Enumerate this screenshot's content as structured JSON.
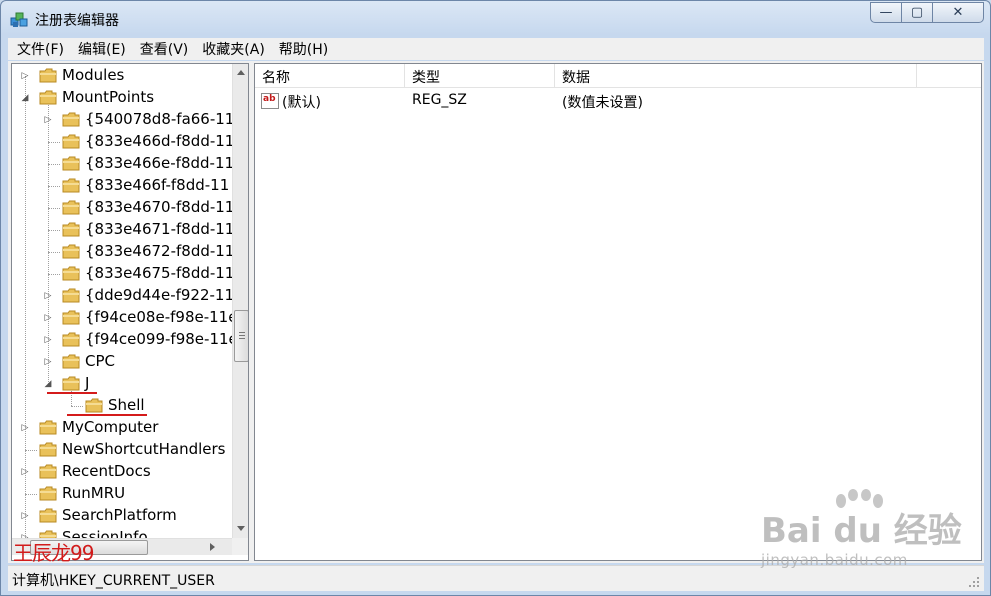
{
  "window": {
    "title": "注册表编辑器",
    "controls": {
      "minimize": "—",
      "maximize": "▢",
      "close": "✕"
    }
  },
  "menu": [
    "文件(F)",
    "编辑(E)",
    "查看(V)",
    "收藏夹(A)",
    "帮助(H)"
  ],
  "tree": {
    "nodes": [
      {
        "label": "Modules",
        "expander": "▷"
      },
      {
        "label": "MountPoints",
        "expander": "◢"
      },
      {
        "label": "{540078d8-fa66-11",
        "expander": "▷"
      },
      {
        "label": "{833e466d-f8dd-11",
        "expander": ""
      },
      {
        "label": "{833e466e-f8dd-11",
        "expander": ""
      },
      {
        "label": "{833e466f-f8dd-11",
        "expander": ""
      },
      {
        "label": "{833e4670-f8dd-11",
        "expander": ""
      },
      {
        "label": "{833e4671-f8dd-11",
        "expander": ""
      },
      {
        "label": "{833e4672-f8dd-11",
        "expander": ""
      },
      {
        "label": "{833e4675-f8dd-11",
        "expander": ""
      },
      {
        "label": "{dde9d44e-f922-11",
        "expander": "▷"
      },
      {
        "label": "{f94ce08e-f98e-11e",
        "expander": "▷"
      },
      {
        "label": "{f94ce099-f98e-11e",
        "expander": "▷"
      },
      {
        "label": "CPC",
        "expander": "▷"
      },
      {
        "label": "J",
        "expander": "◢"
      },
      {
        "label": "Shell",
        "expander": ""
      },
      {
        "label": "MyComputer",
        "expander": "▷"
      },
      {
        "label": "NewShortcutHandlers",
        "expander": ""
      },
      {
        "label": "RecentDocs",
        "expander": "▷"
      },
      {
        "label": "RunMRU",
        "expander": ""
      },
      {
        "label": "SearchPlatform",
        "expander": "▷"
      },
      {
        "label": "SessionInfo",
        "expander": "▷"
      }
    ]
  },
  "list": {
    "columns": [
      "名称",
      "类型",
      "数据"
    ],
    "rows": [
      {
        "name": "(默认)",
        "type": "REG_SZ",
        "data": "(数值未设置)",
        "icon": "ab"
      }
    ]
  },
  "status": {
    "path": "计算机\\HKEY_CURRENT_USER"
  },
  "watermarks": {
    "author": "王辰龙99",
    "brand": "Bai du 经验",
    "brand_url": "jingyan.baidu.com"
  },
  "colors": {
    "annotation_underline": "#d41b1b",
    "author_watermark": "#d21a1a"
  }
}
